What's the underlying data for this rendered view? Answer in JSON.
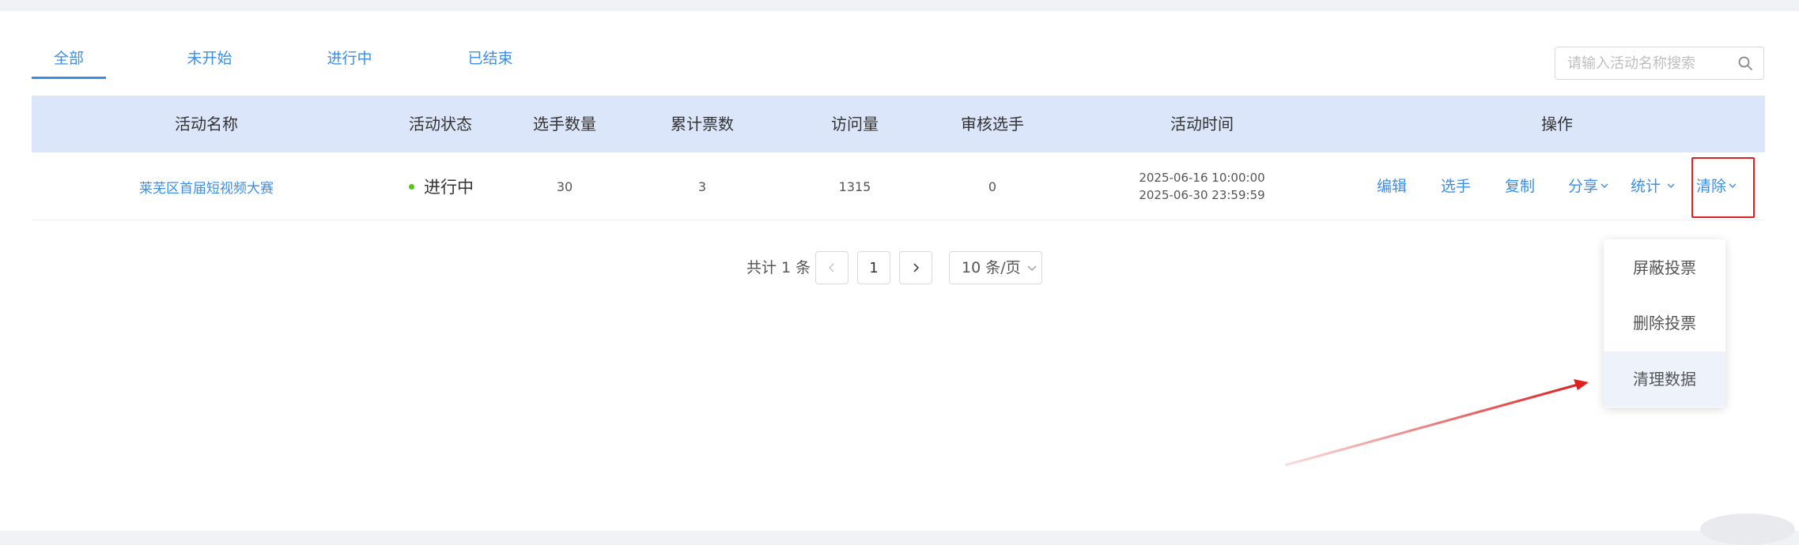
{
  "tabs": [
    {
      "label": "全部",
      "active": true
    },
    {
      "label": "未开始",
      "active": false
    },
    {
      "label": "进行中",
      "active": false
    },
    {
      "label": "已结束",
      "active": false
    }
  ],
  "search": {
    "placeholder": "请输入活动名称搜索",
    "value": ""
  },
  "table": {
    "headers": [
      "活动名称",
      "活动状态",
      "选手数量",
      "累计票数",
      "访问量",
      "审核选手",
      "活动时间",
      "操作"
    ],
    "rows": [
      {
        "name": "莱芜区首届短视频大赛",
        "status": "进行中",
        "players": "30",
        "votes": "3",
        "visits": "1315",
        "pending": "0",
        "start_time": "2025-06-16 10:00:00",
        "end_time": "2025-06-30 23:59:59"
      }
    ],
    "actions": {
      "edit": "编辑",
      "players": "选手",
      "copy": "复制",
      "share": "分享",
      "stats": "统计",
      "clear": "清除"
    }
  },
  "pagination": {
    "total_label": "共计 1 条",
    "current_page": "1",
    "page_size": "10 条/页"
  },
  "clear_menu": {
    "items": [
      "屏蔽投票",
      "删除投票",
      "清理数据"
    ],
    "hovered_index": 2
  },
  "colors": {
    "accent": "#3b8ee8",
    "header_bg": "#dbe6fb",
    "status_active": "#52c41a",
    "annotation_red": "#e02020"
  }
}
